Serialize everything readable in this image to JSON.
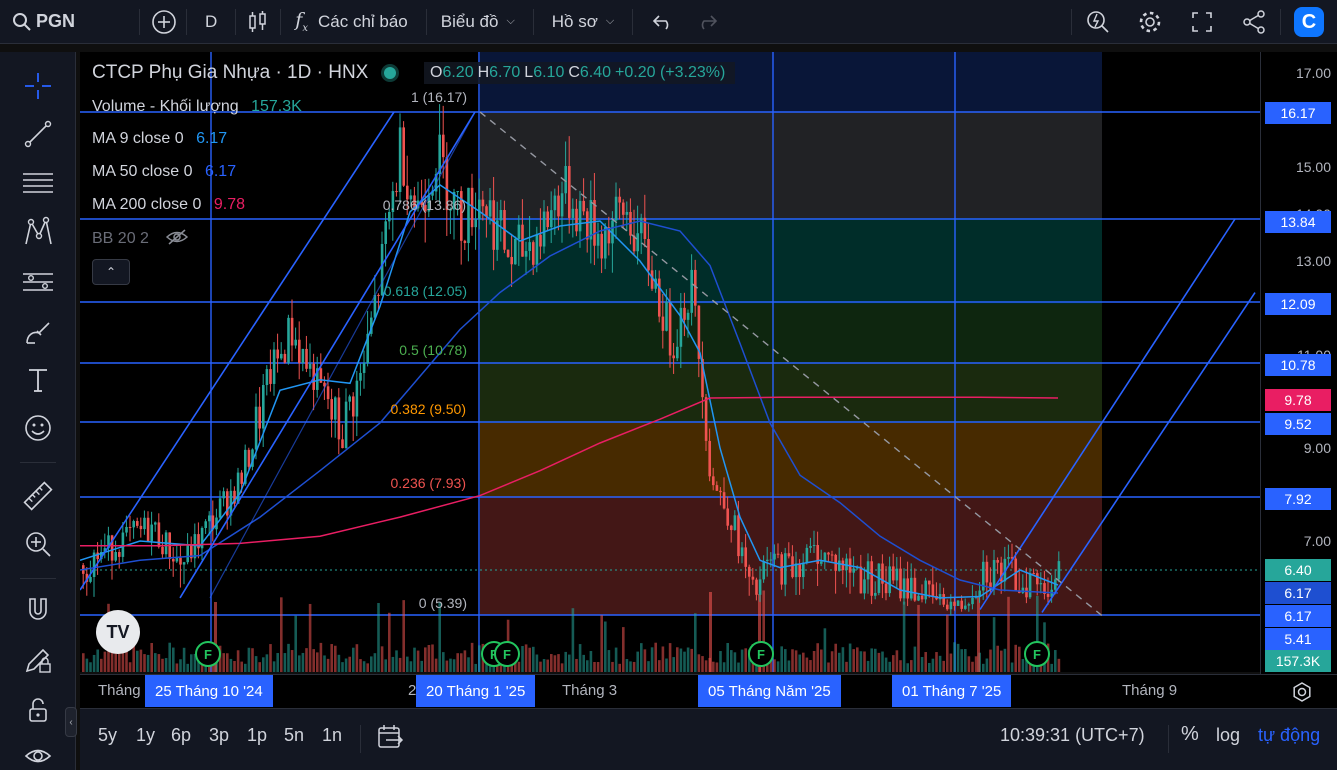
{
  "topbar": {
    "symbol": "PGN",
    "interval": "D",
    "indicators_label": "Các chỉ báo",
    "chart_menu_label": "Biểu đồ",
    "profile_menu_label": "Hồ sơ"
  },
  "legend": {
    "title": "CTCP Phụ Gia Nhựa · 1D · HNX",
    "ohlc": [
      {
        "k": "O",
        "v": "6.20"
      },
      {
        "k": "H",
        "v": "6.70"
      },
      {
        "k": "L",
        "v": "6.10"
      },
      {
        "k": "C",
        "v": "6.40"
      },
      {
        "k": "",
        "v": "+0.20 (+3.23%)"
      }
    ],
    "volume_label": "Volume - Khối lượng",
    "volume_value": "157.3K",
    "ma9_label": "MA 9 close 0",
    "ma9_value": "6.17",
    "ma50_label": "MA 50 close 0",
    "ma50_value": "6.17",
    "ma200_label": "MA 200 close 0",
    "ma200_value": "9.78",
    "bb_label": "BB 20 2"
  },
  "colors": {
    "up": "#26a69a",
    "down": "#ef5350",
    "accent": "#2962ff",
    "ma9": "#2196f3",
    "ma50": "#1e4fd1",
    "ma200": "#e91e63"
  },
  "price_axis": {
    "ticks": [
      "17.00",
      "15.00",
      "14.00",
      "13.00",
      "11.00",
      "9.00",
      "7.00"
    ],
    "badges": [
      {
        "text": "16.17",
        "color": "#2962ff"
      },
      {
        "text": "13.84",
        "color": "#2962ff"
      },
      {
        "text": "12.09",
        "color": "#2962ff"
      },
      {
        "text": "10.78",
        "color": "#2962ff"
      },
      {
        "text": "9.78",
        "color": "#e91e63"
      },
      {
        "text": "9.52",
        "color": "#2962ff"
      },
      {
        "text": "7.92",
        "color": "#2962ff"
      },
      {
        "text": "6.40",
        "color": "#26a69a"
      },
      {
        "text": "6.17",
        "color": "#1e4fd1"
      },
      {
        "text": "6.17",
        "color": "#2962ff"
      },
      {
        "text": "5.41",
        "color": "#2962ff"
      },
      {
        "text": "157.3K",
        "color": "#26a69a"
      }
    ]
  },
  "fib": [
    {
      "label": "1 (16.17)",
      "color": "#b2b5be"
    },
    {
      "label": "0.786 (13.86)",
      "color": "#b2b5be"
    },
    {
      "label": "0.618 (12.05)",
      "color": "#26a69a"
    },
    {
      "label": "0.5 (10.78)",
      "color": "#4caf50"
    },
    {
      "label": "0.382 (9.50)",
      "color": "#ff9800"
    },
    {
      "label": "0.236 (7.93)",
      "color": "#ef5350"
    },
    {
      "label": "0 (5.39)",
      "color": "#b2b5be"
    }
  ],
  "time_axis": {
    "labels": [
      "Tháng",
      "2",
      "Tháng 3",
      "Tháng 9"
    ],
    "badges": [
      "25 Tháng 10 '24",
      "20 Tháng 1 '25",
      "05 Tháng Năm '25",
      "01 Tháng 7 '25"
    ]
  },
  "markers": {
    "f": "F",
    "logo": "TV"
  },
  "bottom": {
    "ranges": [
      "5y",
      "1y",
      "6p",
      "3p",
      "1p",
      "5n",
      "1n"
    ],
    "clock": "10:39:31 (UTC+7)",
    "percent": "%",
    "log": "log",
    "auto": "tự động"
  },
  "icons": {
    "search": "search-icon",
    "add": "plus-circle-icon",
    "candles": "candlestick-icon",
    "fx": "fx-icon",
    "undo": "undo-icon",
    "redo": "redo-icon",
    "alert": "alert-icon",
    "settings": "gear-icon",
    "fullscreen": "fullscreen-icon",
    "share": "share-icon"
  }
}
